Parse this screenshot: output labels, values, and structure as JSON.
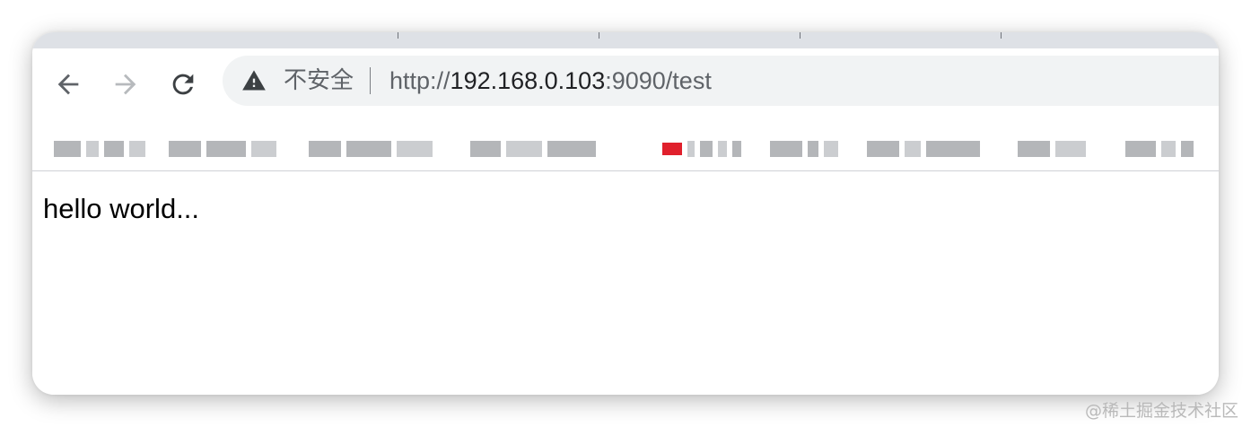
{
  "browser": {
    "nav": {
      "back_icon": "arrow-left-icon",
      "forward_icon": "arrow-right-icon",
      "reload_icon": "reload-icon"
    },
    "omnibox": {
      "security_icon": "warning-triangle-icon",
      "security_label": "不安全",
      "url_scheme": "http://",
      "url_host": "192.168.0.103",
      "url_port": ":9090",
      "url_path": "/test"
    }
  },
  "page": {
    "body_text": "hello world..."
  },
  "watermark": {
    "text": "@稀土掘金技术社区"
  },
  "colors": {
    "tabstrip": "#dee1e6",
    "omnibox_bg": "#f1f3f4",
    "icon": "#5f6368"
  }
}
